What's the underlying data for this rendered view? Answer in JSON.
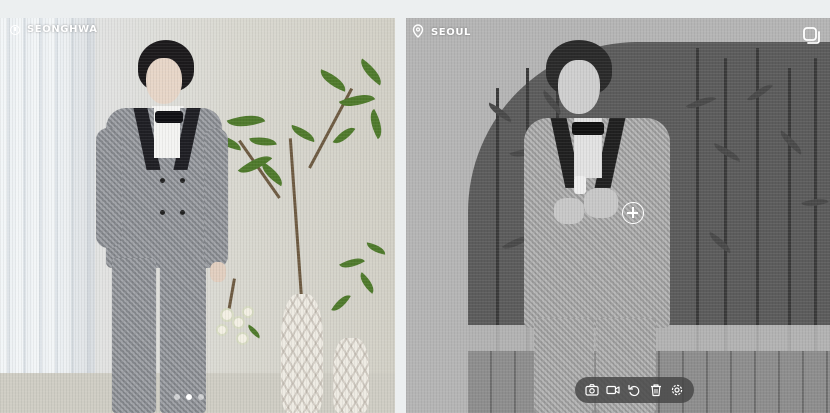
{
  "left_panel": {
    "caption": "SEONGHWA",
    "caption_icon": "info-circle-icon",
    "carousel": {
      "count": 3,
      "active_index": 1
    }
  },
  "right_panel": {
    "caption": "SEOUL",
    "caption_icon": "location-pin-icon",
    "top_right_icon": "copy-icon",
    "focus_icon": "focus-plus-icon",
    "toolbar": [
      {
        "name": "camera-icon",
        "label": "camera"
      },
      {
        "name": "video-icon",
        "label": "video"
      },
      {
        "name": "undo-icon",
        "label": "undo"
      },
      {
        "name": "trash-icon",
        "label": "delete"
      },
      {
        "name": "settings-icon",
        "label": "settings"
      }
    ]
  },
  "colors": {
    "background": "#eceff0",
    "overlay_text": "#ffffff",
    "toolbar_bg": "#464646"
  }
}
